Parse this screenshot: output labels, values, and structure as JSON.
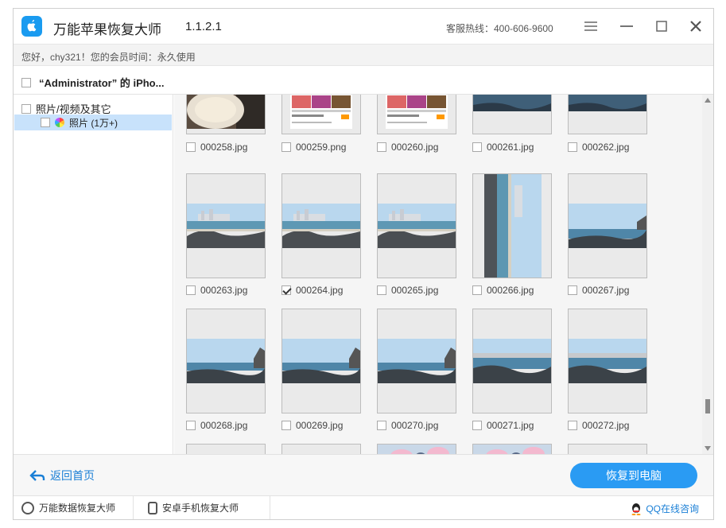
{
  "titlebar": {
    "app_name": "万能苹果恢复大师",
    "version": "1.1.2.1",
    "hotline": "客服热线：400-606-9600"
  },
  "subbar": {
    "greeting": "您好，chy321！您的会员时间：永久使用"
  },
  "device": {
    "name": "“Administrator” 的 iPho..."
  },
  "sidebar": {
    "root_label": "照片/视频及其它",
    "child_label": "照片 (1万+)"
  },
  "files": [
    {
      "name": "000258.jpg",
      "checked": false,
      "kind": "cup"
    },
    {
      "name": "000259.png",
      "checked": false,
      "kind": "screenshot"
    },
    {
      "name": "000260.jpg",
      "checked": false,
      "kind": "screenshot"
    },
    {
      "name": "000261.jpg",
      "checked": false,
      "kind": "sea-top"
    },
    {
      "name": "000262.jpg",
      "checked": false,
      "kind": "sea-top"
    },
    {
      "name": "000263.jpg",
      "checked": false,
      "kind": "beach"
    },
    {
      "name": "000264.jpg",
      "checked": true,
      "kind": "beach"
    },
    {
      "name": "000265.jpg",
      "checked": false,
      "kind": "beach"
    },
    {
      "name": "000266.jpg",
      "checked": false,
      "kind": "beach-vertical"
    },
    {
      "name": "000267.jpg",
      "checked": false,
      "kind": "sea"
    },
    {
      "name": "000268.jpg",
      "checked": false,
      "kind": "sea-rock"
    },
    {
      "name": "000269.jpg",
      "checked": false,
      "kind": "sea-rock"
    },
    {
      "name": "000270.jpg",
      "checked": false,
      "kind": "sea-rock"
    },
    {
      "name": "000271.jpg",
      "checked": false,
      "kind": "sea-wave"
    },
    {
      "name": "000272.jpg",
      "checked": false,
      "kind": "sea-wave"
    }
  ],
  "footer": {
    "back_label": "返回首页",
    "recover_label": "恢复到电脑"
  },
  "statusbar": {
    "item1": "万能数据恢复大师",
    "item2": "安卓手机恢复大师",
    "qq": "QQ在线咨询"
  },
  "colors": {
    "accent": "#2a9bf3",
    "selected_row": "#c8e2fb"
  }
}
